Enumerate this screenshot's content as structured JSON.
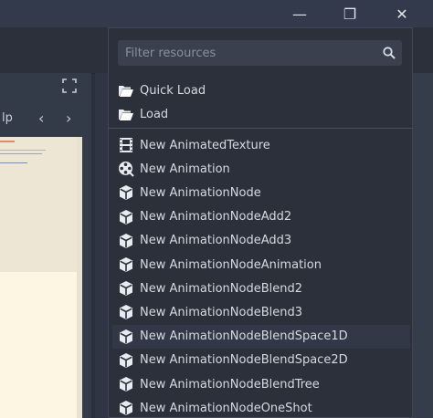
{
  "window_controls": {
    "minimize": "—",
    "restore": "❐",
    "close": "✕"
  },
  "background_panel": {
    "label": "lp",
    "prev": "‹",
    "next": "›",
    "expand": "⛶"
  },
  "popup": {
    "filter_placeholder": "Filter resources",
    "file_actions": [
      {
        "label": "Quick Load",
        "icon": "folder-open-icon"
      },
      {
        "label": "Load",
        "icon": "folder-open-icon"
      }
    ],
    "resources": [
      {
        "label": "New AnimatedTexture",
        "icon": "film-icon"
      },
      {
        "label": "New Animation",
        "icon": "animation-reel-icon"
      },
      {
        "label": "New AnimationNode",
        "icon": "cube-icon"
      },
      {
        "label": "New AnimationNodeAdd2",
        "icon": "cube-icon"
      },
      {
        "label": "New AnimationNodeAdd3",
        "icon": "cube-icon"
      },
      {
        "label": "New AnimationNodeAnimation",
        "icon": "cube-icon"
      },
      {
        "label": "New AnimationNodeBlend2",
        "icon": "cube-icon"
      },
      {
        "label": "New AnimationNodeBlend3",
        "icon": "cube-icon"
      },
      {
        "label": "New AnimationNodeBlendSpace1D",
        "icon": "cube-icon",
        "hovered": true
      },
      {
        "label": "New AnimationNodeBlendSpace2D",
        "icon": "cube-icon"
      },
      {
        "label": "New AnimationNodeBlendTree",
        "icon": "cube-icon"
      },
      {
        "label": "New AnimationNodeOneShot",
        "icon": "cube-icon"
      }
    ]
  }
}
